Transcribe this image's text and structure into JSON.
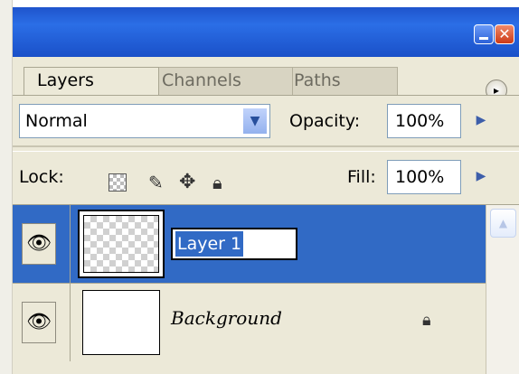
{
  "window": {
    "close_glyph": "✕"
  },
  "tabs": [
    {
      "label": "Layers",
      "active": true
    },
    {
      "label": "Channels",
      "active": false
    },
    {
      "label": "Paths",
      "active": false
    }
  ],
  "panel_menu_glyph": "▸",
  "blend": {
    "mode": "Normal",
    "arrow_glyph": "▼"
  },
  "opacity": {
    "label": "Opacity:",
    "value": "100%",
    "stepper_glyph": "▶"
  },
  "lock": {
    "label": "Lock:",
    "icons": [
      "lock-transparent-icon",
      "lock-image-brush-icon",
      "lock-position-move-icon",
      "lock-all-padlock-icon"
    ]
  },
  "fill": {
    "label": "Fill:",
    "value": "100%",
    "stepper_glyph": "▶"
  },
  "layers": [
    {
      "name": "Layer 1",
      "visible": true,
      "selected": true,
      "editing": true
    },
    {
      "name": "Background",
      "visible": true,
      "selected": false,
      "locked": true
    }
  ],
  "colors": {
    "titlebar": "#2b6ee6",
    "selection": "#316ac5",
    "panel": "#ece9d8"
  }
}
